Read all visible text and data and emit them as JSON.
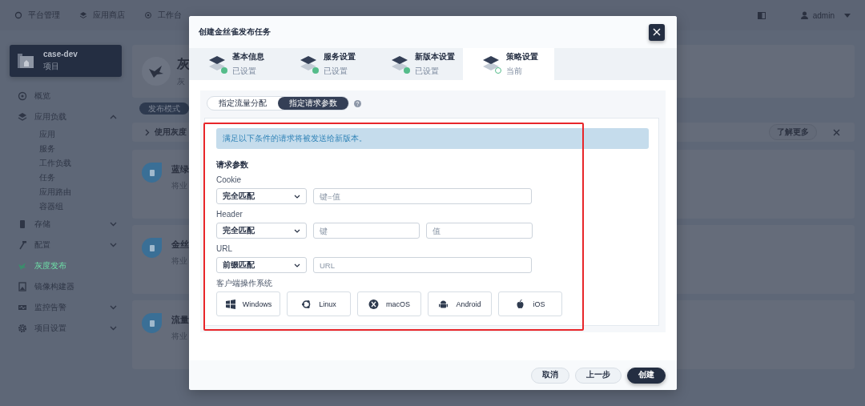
{
  "top_nav": {
    "items": [
      {
        "label": "平台管理"
      },
      {
        "label": "应用商店"
      },
      {
        "label": "工作台"
      }
    ],
    "user": "admin"
  },
  "sidebar": {
    "project": {
      "name": "case-dev",
      "type": "项目"
    },
    "items": [
      {
        "label": "概览",
        "selected": false
      },
      {
        "label": "应用负载",
        "selected": false,
        "expanded": true,
        "children": [
          {
            "label": "应用",
            "selected": false
          },
          {
            "label": "服务",
            "selected": false
          },
          {
            "label": "工作负载",
            "selected": false
          },
          {
            "label": "任务",
            "selected": false
          },
          {
            "label": "应用路由",
            "selected": false
          },
          {
            "label": "容器组",
            "selected": false
          }
        ]
      },
      {
        "label": "存储",
        "selected": false,
        "expanded": false
      },
      {
        "label": "配置",
        "selected": false,
        "expanded": false
      },
      {
        "label": "灰度发布",
        "selected": true
      },
      {
        "label": "镜像构建器",
        "selected": false
      },
      {
        "label": "监控告警",
        "selected": false,
        "expanded": false
      },
      {
        "label": "项目设置",
        "selected": false,
        "expanded": false
      }
    ]
  },
  "main": {
    "header": {
      "title": "灰",
      "subtitle": "灰"
    },
    "tab": "发布模式",
    "banner": {
      "text": "使用灰度",
      "button": "了解更多"
    },
    "cards": [
      {
        "title": "蓝绿",
        "description": "将业"
      },
      {
        "title": "金丝",
        "description": "将业"
      },
      {
        "title": "流量",
        "description": "将业"
      }
    ]
  },
  "modal": {
    "title": "创建金丝雀发布任务",
    "steps": [
      {
        "title": "基本信息",
        "status": "已设置",
        "done": true
      },
      {
        "title": "服务设置",
        "status": "已设置",
        "done": true
      },
      {
        "title": "新版本设置",
        "status": "已设置",
        "done": true
      },
      {
        "title": "策略设置",
        "status": "当前",
        "done": false
      }
    ],
    "mode_tabs": [
      {
        "label": "指定流量分配",
        "selected": false
      },
      {
        "label": "指定请求参数",
        "selected": true
      }
    ],
    "info": "满足以下条件的请求将被发送给新版本。",
    "section_title": "请求参数",
    "fields": [
      {
        "label": "Cookie",
        "match": "完全匹配",
        "inputs": [
          {
            "placeholder": "键=值"
          }
        ]
      },
      {
        "label": "Header",
        "match": "完全匹配",
        "inputs": [
          {
            "placeholder": "键"
          },
          {
            "placeholder": "值"
          }
        ]
      },
      {
        "label": "URL",
        "match": "前缀匹配",
        "inputs": [
          {
            "placeholder": "URL"
          }
        ]
      }
    ],
    "os_label": "客户端操作系统",
    "os_options": [
      {
        "label": "Windows",
        "selected": false
      },
      {
        "label": "Linux",
        "selected": false
      },
      {
        "label": "macOS",
        "selected": false
      },
      {
        "label": "Android",
        "selected": false
      },
      {
        "label": "iOS",
        "selected": false
      }
    ],
    "buttons": [
      {
        "label": "取消",
        "kind": "secondary"
      },
      {
        "label": "上一步",
        "kind": "secondary"
      },
      {
        "label": "创建",
        "kind": "primary"
      }
    ]
  }
}
